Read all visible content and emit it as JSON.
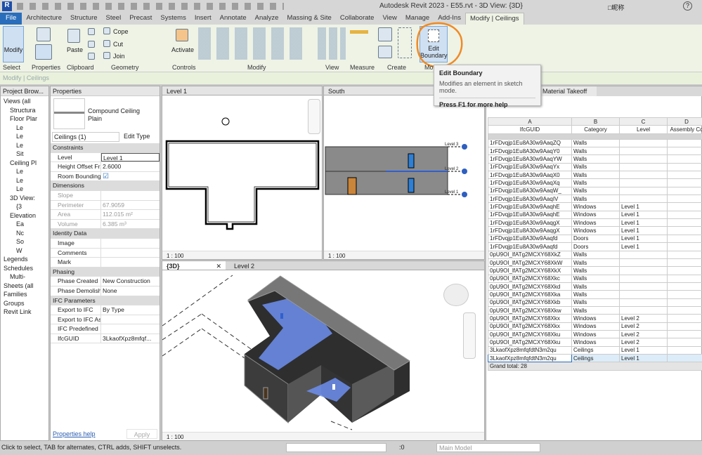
{
  "app": {
    "title": "Autodesk Revit 2023 - E55.rvt - 3D View: {3D}",
    "user": "□昵称"
  },
  "tabs": [
    "File",
    "Architecture",
    "Structure",
    "Steel",
    "Precast",
    "Systems",
    "Insert",
    "Annotate",
    "Analyze",
    "Massing & Site",
    "Collaborate",
    "View",
    "Manage",
    "Add-Ins",
    "Modify | Ceilings"
  ],
  "ribbon": {
    "modify": "Modify",
    "paste": "Paste",
    "cope": "Cope",
    "cut": "Cut",
    "join": "Join",
    "activate": "Activate",
    "edit_boundary": "Edit Boundary",
    "panels": [
      "Select",
      "Properties",
      "Clipboard",
      "Geometry",
      "Controls",
      "Modify",
      "View",
      "Measure",
      "Create",
      "Mo"
    ],
    "highlight_color": "#f08a24"
  },
  "context_bar": "Modify | Ceilings",
  "tooltip": {
    "title": "Edit Boundary",
    "desc": "Modifies an element in sketch mode.",
    "help": "Press F1 for more help"
  },
  "browser": {
    "title": "Project Brow...",
    "items": [
      "Views (all",
      "Structura",
      "Floor Plar",
      "Le",
      "Le",
      "Le",
      "Sit",
      "Ceiling Pl",
      "Le",
      "Le",
      "Le",
      "3D View:",
      "{3",
      "Elevation",
      "Ea",
      "Nc",
      "So",
      "W",
      "Legends",
      "Schedules",
      "Multi-",
      "Sheets (all",
      "Families",
      "Groups",
      "Revit Link"
    ]
  },
  "properties": {
    "title": "Properties",
    "type_name": "Compound Ceiling",
    "type_sub": "Plain",
    "selector": "Ceilings (1)",
    "edit_type": "Edit Type",
    "help": "Properties help",
    "apply": "Apply",
    "rows": [
      {
        "g": "Constraints"
      },
      {
        "k": "Level",
        "v": "Level 1"
      },
      {
        "k": "Height Offset Fr...",
        "v": "2.6000"
      },
      {
        "k": "Room Bounding",
        "v": "☑"
      },
      {
        "g": "Dimensions"
      },
      {
        "k": "Slope",
        "v": "",
        "d": 1
      },
      {
        "k": "Perimeter",
        "v": "67.9059",
        "d": 1
      },
      {
        "k": "Area",
        "v": "112.015 m²",
        "d": 1
      },
      {
        "k": "Volume",
        "v": "6.385 m³",
        "d": 1
      },
      {
        "g": "Identity Data"
      },
      {
        "k": "Image",
        "v": ""
      },
      {
        "k": "Comments",
        "v": ""
      },
      {
        "k": "Mark",
        "v": ""
      },
      {
        "g": "Phasing"
      },
      {
        "k": "Phase Created",
        "v": "New Construction"
      },
      {
        "k": "Phase Demolish...",
        "v": "None"
      },
      {
        "g": "IFC Parameters"
      },
      {
        "k": "Export to IFC",
        "v": "By Type"
      },
      {
        "k": "Export to IFC As",
        "v": ""
      },
      {
        "k": "IFC Predefined ...",
        "v": ""
      },
      {
        "k": "IfcGUID",
        "v": "3LkaofXpz8mfqf..."
      }
    ]
  },
  "views": {
    "level1": "Level 1",
    "south": "South",
    "threed": "{3D}",
    "level2": "Level 2",
    "takeoff": "Material Takeoff",
    "scale": "1 : 100",
    "levels": [
      "Level 3",
      "Level 2",
      "Level 1"
    ]
  },
  "schedule": {
    "letters": [
      "A",
      "B",
      "C",
      "D"
    ],
    "headers": [
      "IfcGUID",
      "Category",
      "Level",
      "Assembly Co"
    ],
    "rows": [
      [
        "1rFDvqjp1Eu8A30w9AaqZQ",
        "Walls",
        ""
      ],
      [
        "1rFDvqjp1Eu8A30w9AaqY0",
        "Walls",
        ""
      ],
      [
        "1rFDvqjp1Eu8A30w9AaqYW",
        "Walls",
        ""
      ],
      [
        "1rFDvqjp1Eu8A30w9AaqYx",
        "Walls",
        ""
      ],
      [
        "1rFDvqjp1Eu8A30w9AaqX0",
        "Walls",
        ""
      ],
      [
        "1rFDvqjp1Eu8A30w9AaqXq",
        "Walls",
        ""
      ],
      [
        "1rFDvqjp1Eu8A30w9AaqW_",
        "Walls",
        ""
      ],
      [
        "1rFDvqjp1Eu8A30w9AaqIV",
        "Walls",
        ""
      ],
      [
        "1rFDvqjp1Eu8A30w9AaqhE",
        "Windows",
        "Level 1"
      ],
      [
        "1rFDvqjp1Eu8A30w9AaqhE",
        "Windows",
        "Level 1"
      ],
      [
        "1rFDvqjp1Eu8A30w9AaqgX",
        "Windows",
        "Level 1"
      ],
      [
        "1rFDvqjp1Eu8A30w9AaqgX",
        "Windows",
        "Level 1"
      ],
      [
        "1rFDvqjp1Eu8A30w9Aaqfd",
        "Doors",
        "Level 1"
      ],
      [
        "1rFDvqjp1Eu8A30w9Aaqfd",
        "Doors",
        "Level 1"
      ],
      [
        "0pU9OI_lfATg2MCXY68XkZ",
        "Walls",
        ""
      ],
      [
        "0pU9OI_lfATg2MCXY68XkW",
        "Walls",
        ""
      ],
      [
        "0pU9OI_lfATg2MCXY68XkX",
        "Walls",
        ""
      ],
      [
        "0pU9OI_lfATg2MCXY68Xkc",
        "Walls",
        ""
      ],
      [
        "0pU9OI_lfATg2MCXY68Xkd",
        "Walls",
        ""
      ],
      [
        "0pU9OI_lfATg2MCXY68Xka",
        "Walls",
        ""
      ],
      [
        "0pU9OI_lfATg2MCXY68Xkb",
        "Walls",
        ""
      ],
      [
        "0pU9OI_lfATg2MCXY68Xkw",
        "Walls",
        ""
      ],
      [
        "0pU9OI_lfATg2MCXY68Xkx",
        "Windows",
        "Level 2"
      ],
      [
        "0pU9OI_lfATg2MCXY68Xkx",
        "Windows",
        "Level 2"
      ],
      [
        "0pU9OI_lfATg2MCXY68Xku",
        "Windows",
        "Level 2"
      ],
      [
        "0pU9OI_lfATg2MCXY68Xku",
        "Windows",
        "Level 2"
      ],
      [
        "3LkaofXpz8mfqfdtN3m2qu",
        "Ceilings",
        "Level 1"
      ],
      [
        "3LkaofXpz8mfqfdtN3m2qu",
        "Ceilings",
        "Level 1"
      ]
    ],
    "grand_total": "Grand total: 28"
  },
  "status": {
    "hint": "Click to select, TAB for alternates, CTRL adds, SHIFT unselects.",
    "count": ":0",
    "model": "Main Model"
  }
}
